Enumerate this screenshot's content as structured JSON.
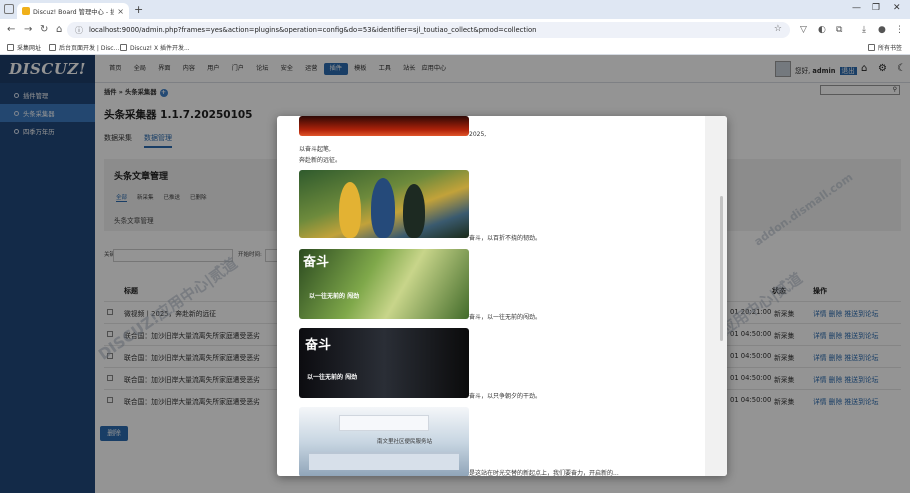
{
  "browser": {
    "tab_title": "Discuz! Board 管理中心 - 插件",
    "url": "localhost:9000/admin.php?frames=yes&action=plugins&operation=config&do=53&identifier=sjl_toutiao_collect&pmod=collection",
    "bookmarks": [
      "采集网址",
      "后台页面开发 | Disc...",
      "Discuz! X 插件开发..."
    ],
    "bookmarks_right": "所有书签"
  },
  "header": {
    "logo": "DISCUZ!",
    "nav": [
      "首页",
      "全局",
      "界面",
      "内容",
      "用户",
      "门户",
      "论坛",
      "安全",
      "运营",
      "插件",
      "模板",
      "工具",
      "站长",
      "应用中心"
    ],
    "active_nav": "插件",
    "greeting": "您好,",
    "username": "admin",
    "logout": "退出"
  },
  "sidebar": {
    "items": [
      {
        "label": "插件管理"
      },
      {
        "label": "头条采集器"
      },
      {
        "label": "四季万年历"
      }
    ]
  },
  "main": {
    "breadcrumb": "插件 » 头条采集器",
    "plugin_title": "头条采集器 1.1.7.20250105",
    "tabs": [
      "数据采集",
      "数据管理"
    ],
    "panel_title": "头条文章管理",
    "panel_tabs": [
      "全部",
      "新采集",
      "已推送",
      "已删除"
    ],
    "panel_sub": "头条文章管理",
    "filter_keyword": "关键词:",
    "filter_start": "开始时间:",
    "col_title": "标题",
    "col_status": "状态",
    "col_ops": "操作",
    "rows": [
      {
        "title": "微视频丨2025，奔赴新的远征",
        "time": "01 20:21:00",
        "status": "新采集",
        "ops": "详情 删除 推送到论坛"
      },
      {
        "title": "联合国：加沙旧岸大量流离失所家庭遭受恶劣",
        "time": "01 04:50:00",
        "status": "新采集",
        "ops": "详情 删除 推送到论坛"
      },
      {
        "title": "联合国：加沙旧岸大量流离失所家庭遭受恶劣",
        "time": "01 04:50:00",
        "status": "新采集",
        "ops": "详情 删除 推送到论坛"
      },
      {
        "title": "联合国：加沙旧岸大量流离失所家庭遭受恶劣",
        "time": "01 04:50:00",
        "status": "新采集",
        "ops": "详情 删除 推送到论坛"
      },
      {
        "title": "联合国：加沙旧岸大量流离失所家庭遭受恶劣",
        "time": "01 04:50:00",
        "status": "新采集",
        "ops": "详情 删除 推送到论坛"
      }
    ],
    "delete_button": "删除",
    "watermarks": [
      "DISCUZ!应用中心|贰道",
      "addon.dismall.com"
    ]
  },
  "modal": {
    "text_year": "2025,",
    "line1": "以奋斗起笔,",
    "line2": "奔赴新的远征。",
    "caption1": "奋斗，以百折不挠的韧劲。",
    "caption2": "奋斗，以一往无前的闯劲。",
    "caption3": "奋斗，以只争朝夕的干劲。",
    "caption4": "是这站在时光交替的新起点上，我们要奋力，开启新的...",
    "photo2_text": "奋斗",
    "photo2_sub": "以一往无前的 闯劲",
    "photo3_text": "奋斗",
    "photo3_sub": "以一往无前的 闯劲",
    "photo4_banner": "南文里社区便民服务站"
  }
}
